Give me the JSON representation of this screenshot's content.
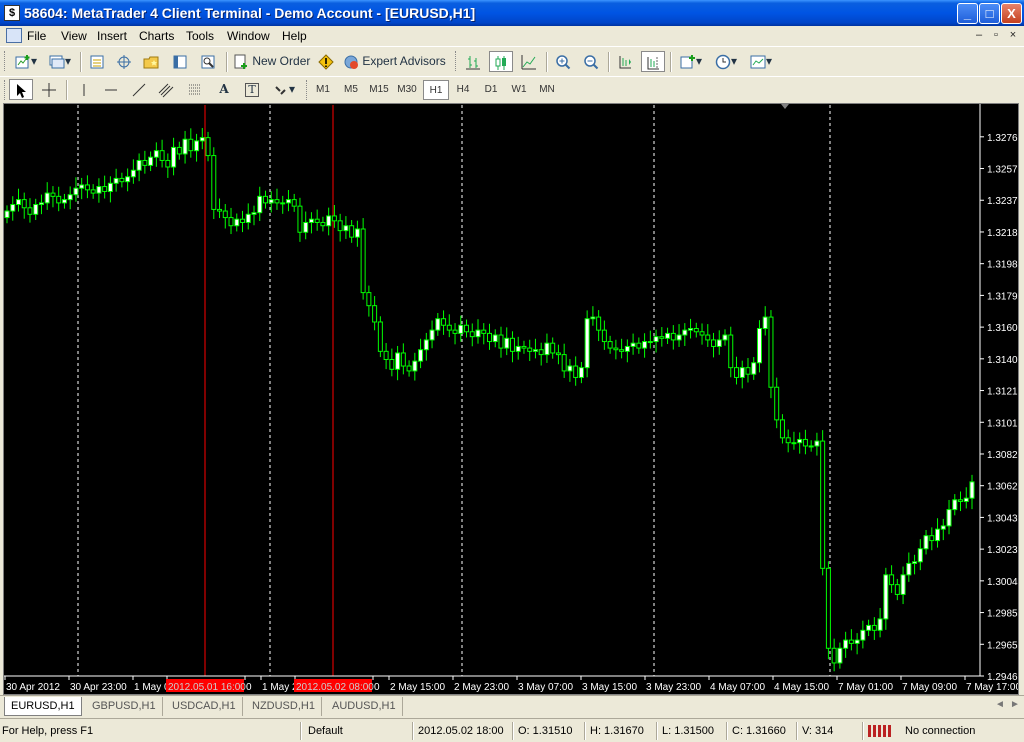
{
  "window": {
    "title": "58604: MetaTrader 4 Client Terminal - Demo Account - [EURUSD,H1]",
    "app_icon_label": "$",
    "buttons": {
      "minimize": "_",
      "maximize": "□",
      "close": "X"
    }
  },
  "menu": [
    "File",
    "View",
    "Insert",
    "Charts",
    "Tools",
    "Window",
    "Help"
  ],
  "toolbar": {
    "new_order": "New Order",
    "expert_advisors": "Expert Advisors"
  },
  "timeframes": [
    "M1",
    "M5",
    "M15",
    "M30",
    "H1",
    "H4",
    "D1",
    "W1",
    "MN"
  ],
  "selected_timeframe": "H1",
  "line_tools": {
    "text_tool": "A",
    "label_tool": "T"
  },
  "chart_data": {
    "type": "candlestick",
    "symbol": "EURUSD",
    "timeframe": "H1",
    "y_ticks": [
      "1.32765",
      "1.32570",
      "1.32375",
      "1.32180",
      "1.31985",
      "1.31790",
      "1.31600",
      "1.31405",
      "1.31210",
      "1.31015",
      "1.30820",
      "1.30625",
      "1.30430",
      "1.30235",
      "1.30040",
      "1.29850",
      "1.29655",
      "1.29460"
    ],
    "x_ticks": [
      "30 Apr 2012",
      "30 Apr 23:00",
      "1 May 0",
      "2012.05.01 16:00",
      "0",
      "1 May 2",
      "2012.05.02 08:00",
      "0",
      "2 May 15:00",
      "2 May 23:00",
      "3 May 07:00",
      "3 May 15:00",
      "3 May 23:00",
      "4 May 07:00",
      "4 May 15:00",
      "7 May 01:00",
      "7 May 09:00",
      "7 May 17:00"
    ],
    "ylim": [
      1.2946,
      1.3296
    ],
    "marked_times": [
      "2012.05.01 16:00",
      "2012.05.02 08:00"
    ],
    "candles_close": [
      1.3231,
      1.3235,
      1.3238,
      1.3233,
      1.3229,
      1.3235,
      1.3236,
      1.3242,
      1.324,
      1.3236,
      1.3238,
      1.3241,
      1.3245,
      1.3247,
      1.3244,
      1.3242,
      1.3246,
      1.3243,
      1.3248,
      1.3251,
      1.3249,
      1.3252,
      1.3256,
      1.3262,
      1.3259,
      1.3264,
      1.3268,
      1.3262,
      1.3258,
      1.327,
      1.3266,
      1.3275,
      1.3268,
      1.3274,
      1.3276,
      1.3265,
      1.3232,
      1.3231,
      1.3227,
      1.3222,
      1.3226,
      1.3224,
      1.3229,
      1.323,
      1.324,
      1.3236,
      1.3238,
      1.3236,
      1.3236,
      1.3238,
      1.3234,
      1.3218,
      1.3224,
      1.3226,
      1.3224,
      1.3222,
      1.3228,
      1.3225,
      1.3219,
      1.3222,
      1.3215,
      1.322,
      1.3181,
      1.3173,
      1.3163,
      1.3145,
      1.314,
      1.3134,
      1.3144,
      1.3136,
      1.3133,
      1.3139,
      1.3146,
      1.3152,
      1.3158,
      1.3165,
      1.3161,
      1.3158,
      1.3156,
      1.3161,
      1.3157,
      1.3154,
      1.3158,
      1.3156,
      1.3151,
      1.3155,
      1.3147,
      1.3153,
      1.3145,
      1.3148,
      1.3147,
      1.3145,
      1.3146,
      1.3143,
      1.315,
      1.3144,
      1.3143,
      1.3133,
      1.3136,
      1.3129,
      1.3135,
      1.3165,
      1.3166,
      1.3158,
      1.3151,
      1.3147,
      1.3146,
      1.3145,
      1.3148,
      1.315,
      1.3147,
      1.3151,
      1.3151,
      1.3154,
      1.3153,
      1.3156,
      1.3152,
      1.3155,
      1.3158,
      1.3159,
      1.3157,
      1.3155,
      1.3152,
      1.3148,
      1.3152,
      1.3155,
      1.3135,
      1.3129,
      1.3135,
      1.3131,
      1.3138,
      1.3159,
      1.3166,
      1.3123,
      1.3103,
      1.3092,
      1.3089,
      1.3089,
      1.3091,
      1.3087,
      1.3087,
      1.309,
      1.3012,
      1.2963,
      1.2954,
      1.2963,
      1.2968,
      1.2966,
      1.2968,
      1.2974,
      1.2977,
      1.2974,
      1.2981,
      1.3008,
      1.3002,
      1.2996,
      1.3008,
      1.3015,
      1.3016,
      1.3024,
      1.3032,
      1.3029,
      1.3036,
      1.3038,
      1.3048,
      1.3054,
      1.3053,
      1.3055,
      1.3065
    ]
  },
  "tabs": [
    "EURUSD,H1",
    "GBPUSD,H1",
    "USDCAD,H1",
    "NZDUSD,H1",
    "AUDUSD,H1"
  ],
  "active_tab": "EURUSD,H1",
  "tab_arrows": {
    "left": "◄",
    "right": "►"
  },
  "status": {
    "help": "For Help, press F1",
    "profile": "Default",
    "datetime": "2012.05.02 18:00",
    "open": "O: 1.31510",
    "high": "H: 1.31670",
    "low": "L: 1.31500",
    "close": "C: 1.31660",
    "volume": "V: 314",
    "connection": "No connection"
  },
  "colors": {
    "bull": "#ffffff",
    "bear": "#000000",
    "wick": "#00ff00",
    "grid": "#ffffff",
    "marker": "#ff0000"
  }
}
